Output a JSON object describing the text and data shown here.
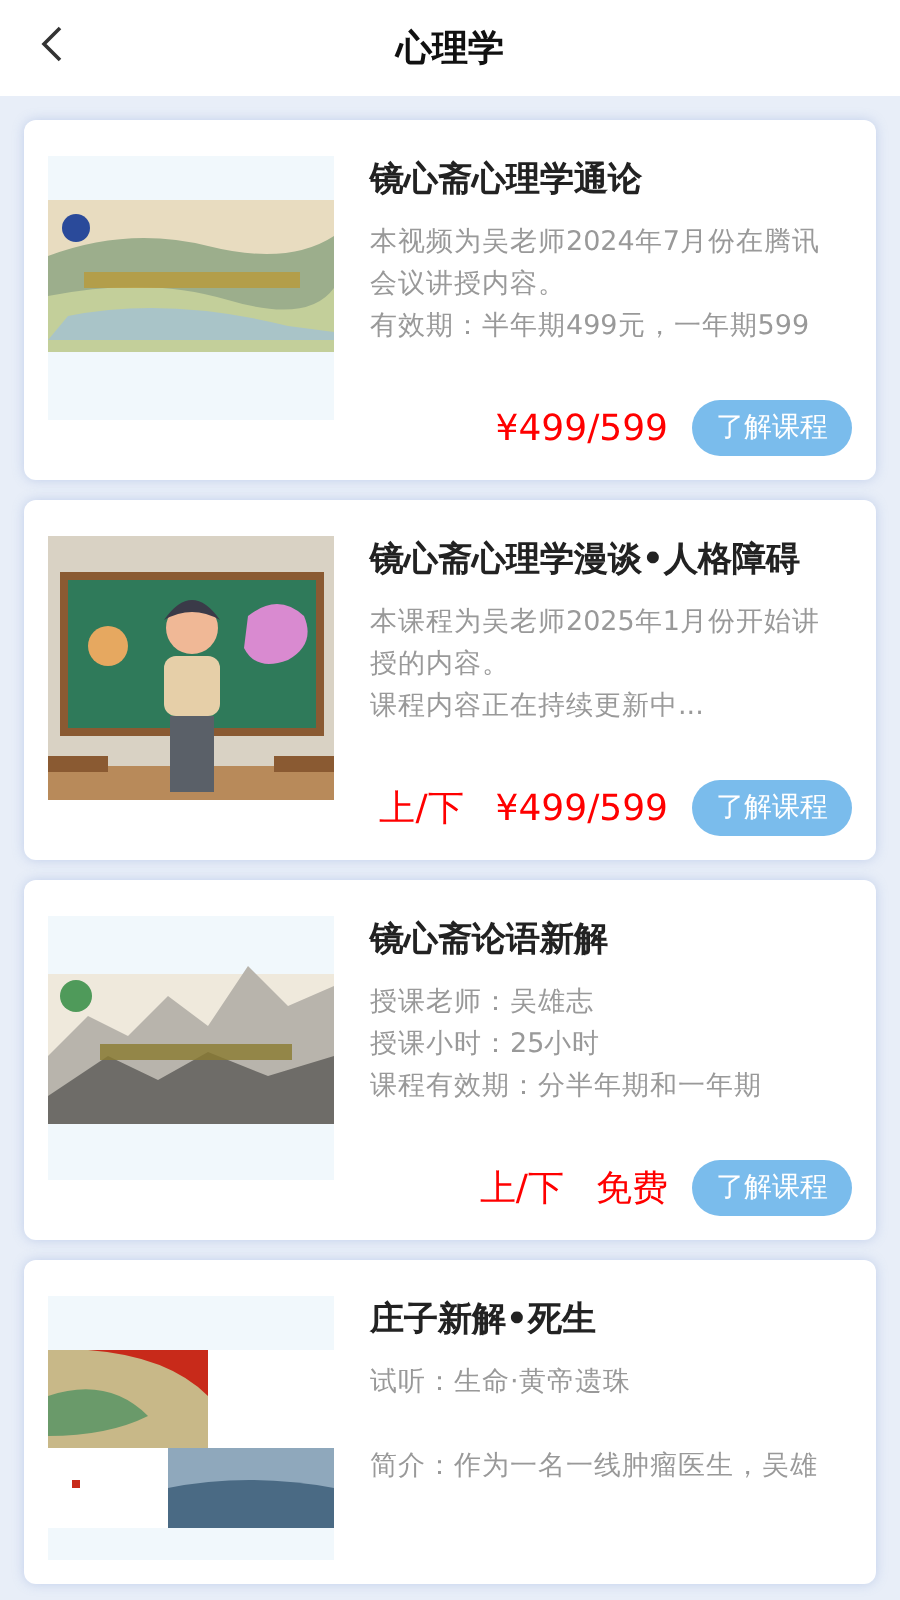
{
  "header": {
    "title": "心理学"
  },
  "courses": [
    {
      "kind": "landscape",
      "title": "镜心斋心理学通论",
      "lines": [
        "本视频为吴老师2024年7月份在腾讯会议讲授内容。",
        "有效期：半年期499元，一年期599"
      ],
      "price": "¥499/599",
      "button": "了解课程"
    },
    {
      "kind": "classroom",
      "title": "镜心斋心理学漫谈•人格障碍",
      "lines": [
        "本课程为吴老师2025年1月份开始讲授的内容。",
        "课程内容正在持续更新中..."
      ],
      "tag": "上/下",
      "price": "¥499/599",
      "button": "了解课程"
    },
    {
      "kind": "ink",
      "title": "镜心斋论语新解",
      "lines": [
        "授课老师：吴雄志",
        "授课小时：25小时",
        "课程有效期：分半年期和一年期"
      ],
      "tag": "上/下",
      "price": "免费",
      "button": "了解课程"
    },
    {
      "kind": "painting",
      "title": "庄子新解•死生",
      "lines": [
        "试听：生命·黄帝遗珠",
        "简介：作为一名一线肿瘤医生，吴雄"
      ]
    }
  ]
}
